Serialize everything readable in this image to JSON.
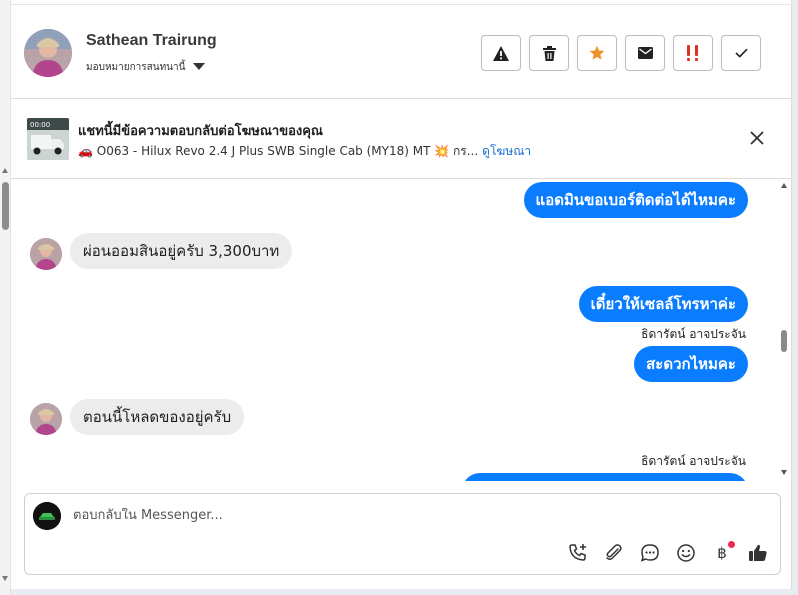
{
  "header": {
    "contact_name": "Sathean Trairung",
    "assign_label": "มอบหมายการสนทนานี้"
  },
  "ad": {
    "title": "แชทนี้มีข้อความตอบกลับต่อโฆษณาของคุณ",
    "subtitle": "🚗 O063 - Hilux Revo 2.4 J Plus SWB Single Cab (MY18) MT 💥 กร...",
    "link": "ดูโฆษณา",
    "thumb_label": "00:00"
  },
  "messages": [
    {
      "dir": "out",
      "text": "แอดมินขอเบอร์ติดต่อได้ไหมคะ"
    },
    {
      "dir": "in",
      "text": "ผ่อนออมสินอยู่ครับ  3,300บาท"
    },
    {
      "dir": "out",
      "text": "เดี๋ยวให้เซลล์โทรหาค่ะ"
    },
    {
      "sender": "ธิดารัตน์ อาจประจัน"
    },
    {
      "dir": "out",
      "text": "สะดวกไหมคะ"
    },
    {
      "dir": "in",
      "text": "ตอนนี้โหลดของอยู่ครับ"
    },
    {
      "sender": "ธิดารัตน์ อาจประจัน"
    }
  ],
  "composer": {
    "placeholder": "ตอบกลับใน Messenger...",
    "baht_symbol": "฿"
  },
  "colors": {
    "outgoing_bubble": "#0a7cff",
    "incoming_bubble": "#ececec",
    "link": "#1b6fd8",
    "star": "#f0922b",
    "urgent": "#e0301e",
    "notify_dot": "#f0284a"
  },
  "icons": [
    "warning-icon",
    "trash-icon",
    "star-icon",
    "envelope-icon",
    "urgent-icon",
    "check-icon",
    "close-icon",
    "phone-add-icon",
    "paperclip-icon",
    "chat-bubble-icon",
    "emoji-icon",
    "baht-icon",
    "thumbs-up-icon",
    "caret-down-icon"
  ]
}
